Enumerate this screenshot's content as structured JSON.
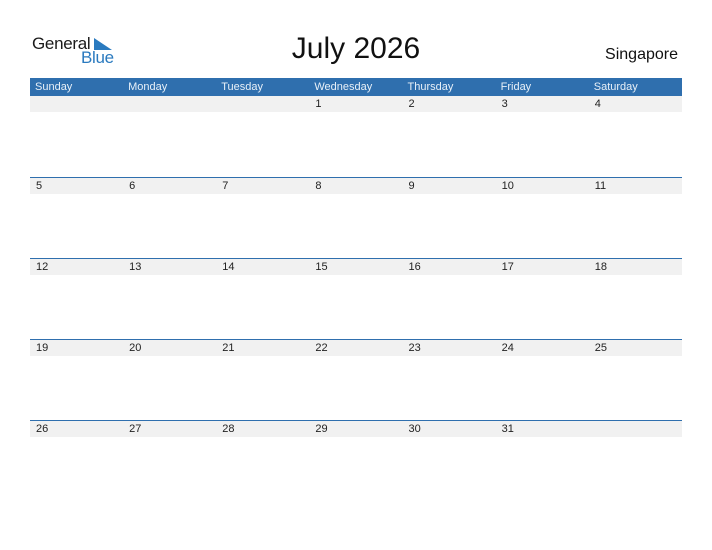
{
  "logo": {
    "line1": "General",
    "line2": "Blue"
  },
  "title": "July 2026",
  "country": "Singapore",
  "weekdays": [
    "Sunday",
    "Monday",
    "Tuesday",
    "Wednesday",
    "Thursday",
    "Friday",
    "Saturday"
  ],
  "weeks": [
    [
      "",
      "",
      "",
      "1",
      "2",
      "3",
      "4"
    ],
    [
      "5",
      "6",
      "7",
      "8",
      "9",
      "10",
      "11"
    ],
    [
      "12",
      "13",
      "14",
      "15",
      "16",
      "17",
      "18"
    ],
    [
      "19",
      "20",
      "21",
      "22",
      "23",
      "24",
      "25"
    ],
    [
      "26",
      "27",
      "28",
      "29",
      "30",
      "31",
      ""
    ]
  ],
  "colors": {
    "accent": "#2f6fae",
    "logo_blue": "#2a7abf",
    "row_bg": "#f1f1f1"
  }
}
